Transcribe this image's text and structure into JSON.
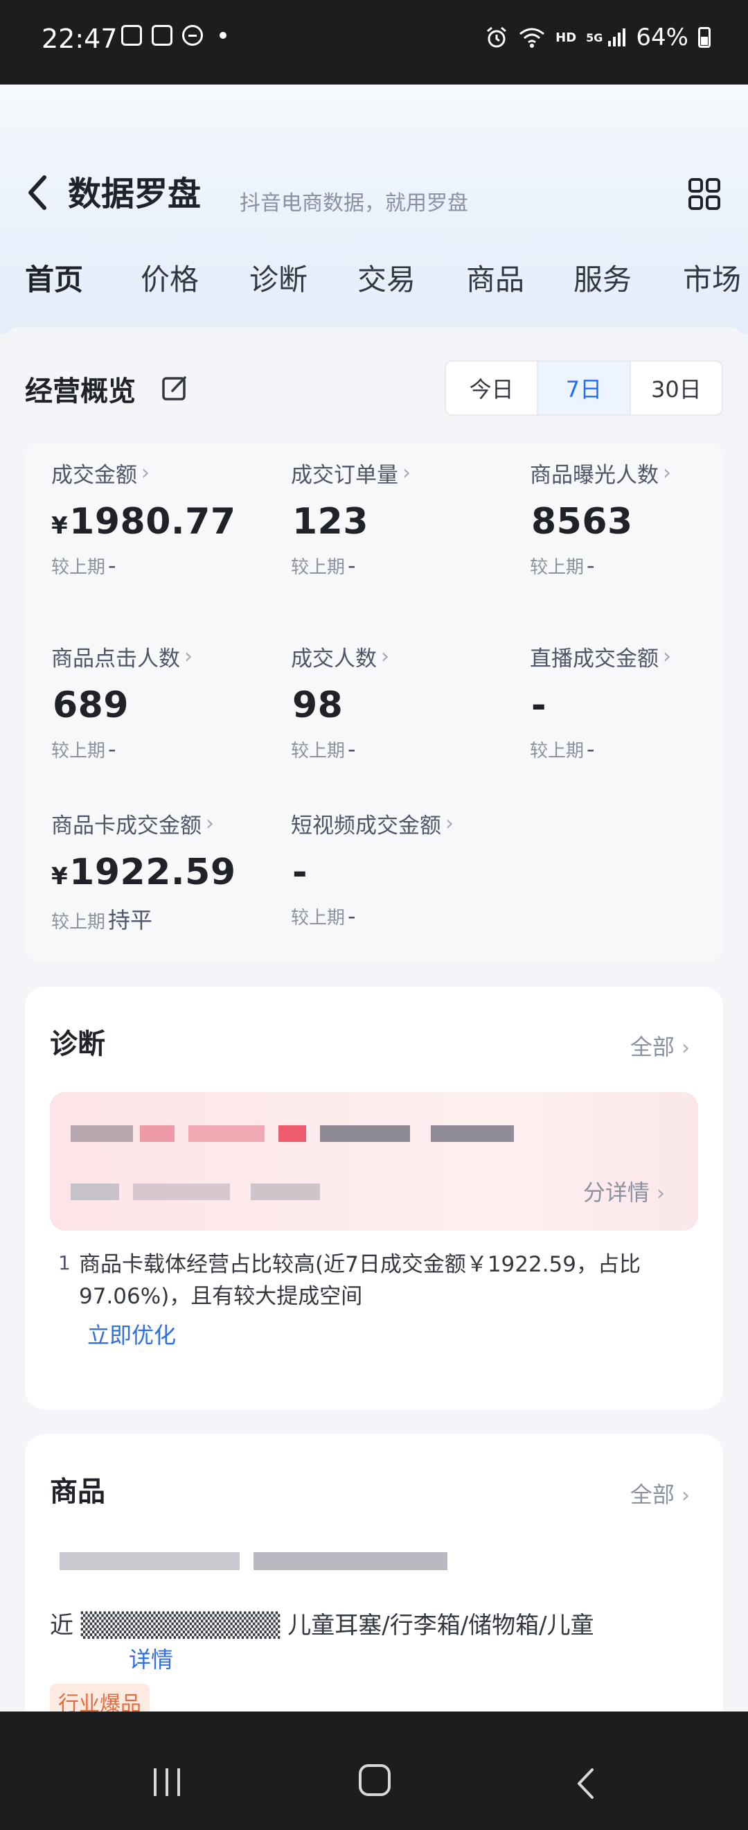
{
  "status_bar": {
    "time": "22:47",
    "network": "HD",
    "signal": "5G",
    "battery": "64%"
  },
  "header": {
    "title": "数据罗盘",
    "subtitle": "抖音电商数据，就用罗盘"
  },
  "tabs": [
    {
      "label": "首页",
      "active": true
    },
    {
      "label": "价格",
      "active": false
    },
    {
      "label": "诊断",
      "active": false
    },
    {
      "label": "交易",
      "active": false
    },
    {
      "label": "商品",
      "active": false
    },
    {
      "label": "服务",
      "active": false
    },
    {
      "label": "市场",
      "active": false
    }
  ],
  "overview": {
    "title": "经营概览",
    "periods": [
      {
        "label": "今日",
        "active": false
      },
      {
        "label": "7日",
        "active": true
      },
      {
        "label": "30日",
        "active": false
      }
    ],
    "compare_label": "较上期",
    "metrics": [
      {
        "label": "成交金额",
        "currency": "¥",
        "value": "1980.77",
        "compare": "-"
      },
      {
        "label": "成交订单量",
        "currency": "",
        "value": "123",
        "compare": "-"
      },
      {
        "label": "商品曝光人数",
        "currency": "",
        "value": "8563",
        "compare": "-"
      },
      {
        "label": "商品点击人数",
        "currency": "",
        "value": "689",
        "compare": "-"
      },
      {
        "label": "成交人数",
        "currency": "",
        "value": "98",
        "compare": "-"
      },
      {
        "label": "直播成交金额",
        "currency": "",
        "value": "-",
        "compare": "-"
      },
      {
        "label": "商品卡成交金额",
        "currency": "¥",
        "value": "1922.59",
        "compare": "持平"
      },
      {
        "label": "短视频成交金额",
        "currency": "",
        "value": "-",
        "compare": "-"
      }
    ]
  },
  "diagnosis": {
    "title": "诊断",
    "more": "全部",
    "banner_detail": "分详情",
    "item_no": "1",
    "item_text": "商品卡载体经营占比较高(近7日成交金额￥1922.59，占比97.06%)，且有较大提成空间",
    "action": "立即优化"
  },
  "products": {
    "title": "商品",
    "more": "全部",
    "line": "近 ▒▒▒▒▒▒▒▒▒▒▒ 儿童耳塞/行李箱/储物箱/儿童",
    "detail_link": "详情",
    "badge": "行业爆品"
  }
}
